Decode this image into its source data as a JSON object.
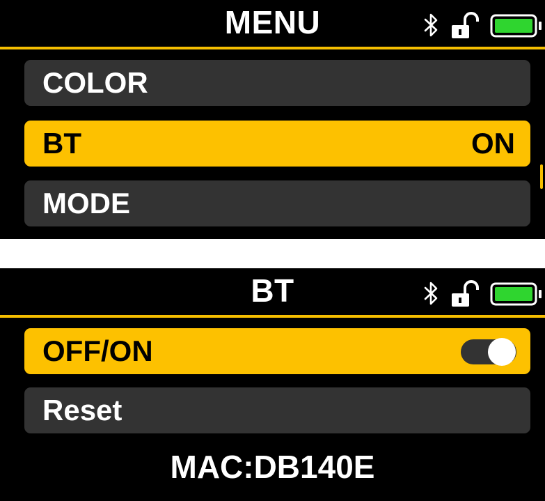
{
  "screens": [
    {
      "title": "MENU",
      "items": [
        {
          "label": "COLOR",
          "value": ""
        },
        {
          "label": "BT",
          "value": "ON"
        },
        {
          "label": "MODE",
          "value": ""
        }
      ],
      "selected_index": 1
    },
    {
      "title": "BT",
      "items": [
        {
          "label": "OFF/ON",
          "toggle_state": "on"
        },
        {
          "label": "Reset"
        }
      ],
      "selected_index": 0,
      "mac": "MAC:DB140E"
    }
  ],
  "status_icons": [
    "bluetooth-icon",
    "lock-open-icon",
    "battery-icon"
  ],
  "colors": {
    "accent": "#FDC100",
    "background": "#000000",
    "item_background": "#333333",
    "battery_fill": "#2FD52F",
    "text": "#FFFFFF"
  },
  "battery_level": 1.0
}
